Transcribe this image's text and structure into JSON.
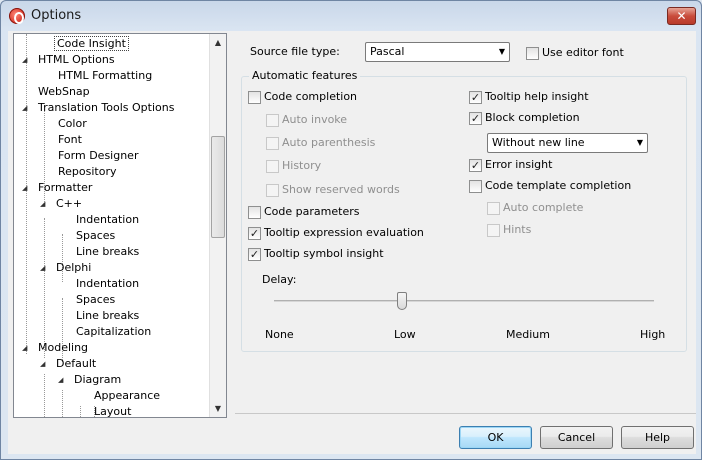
{
  "window": {
    "title": "Options"
  },
  "tree": {
    "items": [
      {
        "label": "Code Insight"
      },
      {
        "label": "HTML Options"
      },
      {
        "label": "HTML Formatting"
      },
      {
        "label": "WebSnap"
      },
      {
        "label": "Translation Tools Options"
      },
      {
        "label": "Color"
      },
      {
        "label": "Font"
      },
      {
        "label": "Form Designer"
      },
      {
        "label": "Repository"
      },
      {
        "label": "Formatter"
      },
      {
        "label": "C++"
      },
      {
        "label": "Indentation"
      },
      {
        "label": "Spaces"
      },
      {
        "label": "Line breaks"
      },
      {
        "label": "Delphi"
      },
      {
        "label": "Indentation"
      },
      {
        "label": "Spaces"
      },
      {
        "label": "Line breaks"
      },
      {
        "label": "Capitalization"
      },
      {
        "label": "Modeling"
      },
      {
        "label": "Default"
      },
      {
        "label": "Diagram"
      },
      {
        "label": "Appearance"
      },
      {
        "label": "Layout"
      }
    ]
  },
  "source": {
    "label": "Source file type:",
    "value": "Pascal",
    "use_editor_font": "Use editor font"
  },
  "features": {
    "caption": "Automatic features",
    "code_completion": "Code completion",
    "auto_invoke": "Auto invoke",
    "auto_parenthesis": "Auto parenthesis",
    "history": "History",
    "show_reserved_words": "Show reserved words",
    "code_parameters": "Code parameters",
    "tooltip_expression_evaluation": "Tooltip expression evaluation",
    "tooltip_symbol_insight": "Tooltip symbol insight",
    "tooltip_help_insight": "Tooltip help insight",
    "block_completion": "Block completion",
    "block_completion_mode": "Without new line",
    "error_insight": "Error insight",
    "code_template_completion": "Code template completion",
    "auto_complete": "Auto complete",
    "hints": "Hints",
    "check_mark": "✓"
  },
  "delay": {
    "label": "Delay:",
    "ticks": [
      "None",
      "Low",
      "Medium",
      "High"
    ],
    "value": "Low"
  },
  "buttons": {
    "ok": "OK",
    "cancel": "Cancel",
    "help": "Help"
  }
}
